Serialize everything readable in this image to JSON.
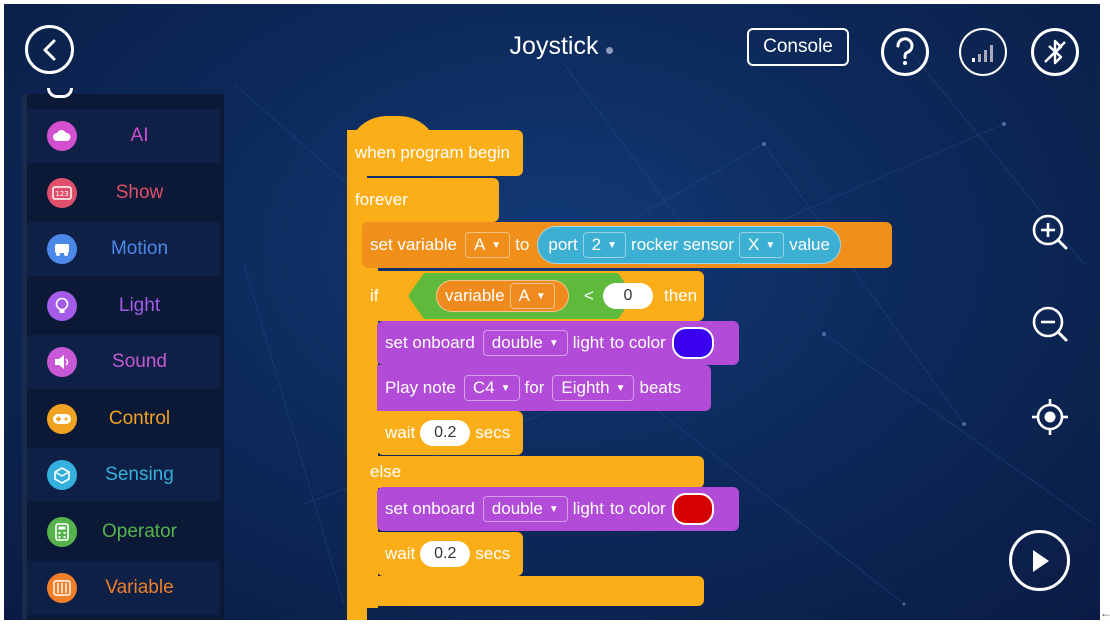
{
  "header": {
    "title": "Joystick",
    "console_label": "Console",
    "icons": [
      "back-arrow-icon",
      "help-icon",
      "signal-icon",
      "bluetooth-off-icon"
    ]
  },
  "palette": {
    "categories": [
      {
        "label": "AI",
        "color": "#d24fd0",
        "icon": "cloud-icon"
      },
      {
        "label": "Show",
        "color": "#e0506a",
        "icon": "display-123-icon"
      },
      {
        "label": "Motion",
        "color": "#4c88e8",
        "icon": "car-icon"
      },
      {
        "label": "Light",
        "color": "#a45ce8",
        "icon": "bulb-icon"
      },
      {
        "label": "Sound",
        "color": "#c859d6",
        "icon": "speaker-icon"
      },
      {
        "label": "Control",
        "color": "#f0a322",
        "icon": "gamepad-icon"
      },
      {
        "label": "Sensing",
        "color": "#35b0dc",
        "icon": "cube-icon"
      },
      {
        "label": "Operator",
        "color": "#56b24c",
        "icon": "calculator-icon"
      },
      {
        "label": "Variable",
        "color": "#ef7f28",
        "icon": "sliders-icon"
      }
    ]
  },
  "script": {
    "hat": "when program begin",
    "forever": "forever",
    "set_var": {
      "prefix": "set variable",
      "var": "A",
      "to": "to",
      "port_label": "port",
      "port": "2",
      "sensor": "rocker sensor",
      "axis": "X",
      "value": "value"
    },
    "if": {
      "label": "if",
      "cond_var_label": "variable",
      "cond_var": "A",
      "op": "<",
      "rhs": "0",
      "then": "then"
    },
    "then_light": {
      "prefix": "set onboard",
      "mode": "double",
      "suffix1": "light",
      "suffix2": "to color",
      "color": "#3a00f0"
    },
    "play": {
      "prefix": "Play note",
      "note": "C4",
      "for": "for",
      "beat": "Eighth",
      "beats": "beats"
    },
    "wait1": {
      "prefix": "wait",
      "value": "0.2",
      "suffix": "secs"
    },
    "else": "else",
    "else_light": {
      "prefix": "set onboard",
      "mode": "double",
      "suffix1": "light",
      "suffix2": "to color",
      "color": "#d60000"
    },
    "wait2": {
      "prefix": "wait",
      "value": "0.2",
      "suffix": "secs"
    }
  },
  "controls": {
    "icons": [
      "zoom-in-icon",
      "zoom-out-icon",
      "locate-icon",
      "run-icon"
    ]
  }
}
